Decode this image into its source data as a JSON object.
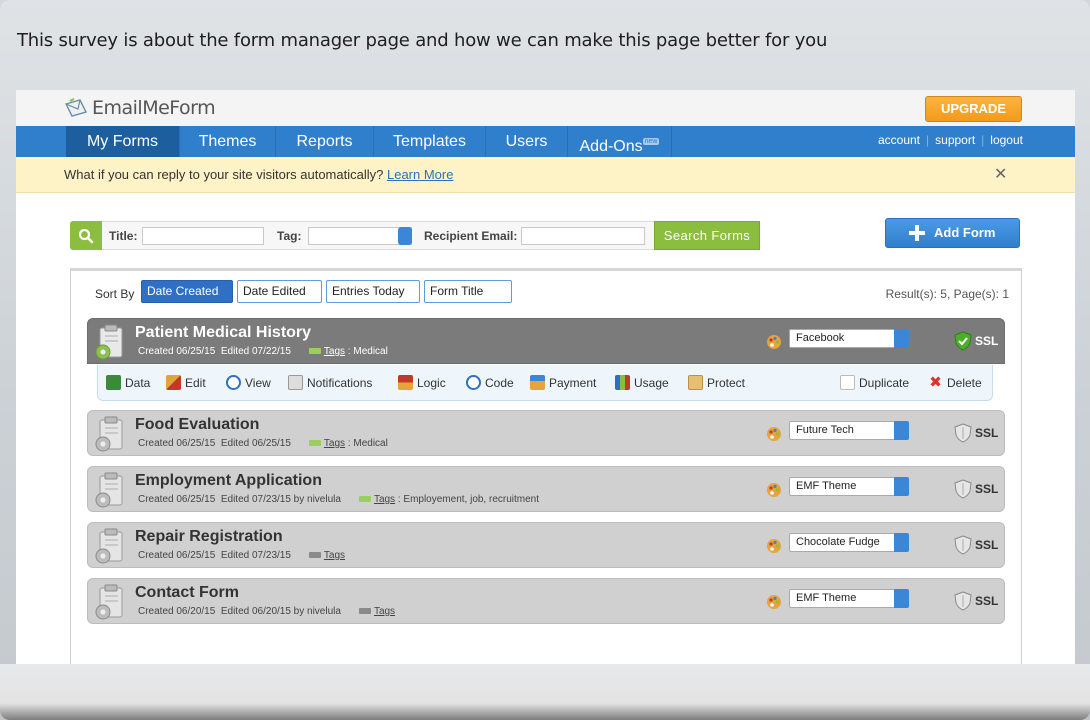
{
  "survey_text": "This survey is about the form manager page and how we can make this page better for you",
  "header": {
    "logo_text": "EmailMeForm",
    "upgrade_label": "UPGRADE"
  },
  "nav": {
    "items": [
      "My Forms",
      "Themes",
      "Reports",
      "Templates",
      "Users",
      "Add-Ons"
    ],
    "addons_badge": "new",
    "account": "account",
    "support": "support",
    "logout": "logout"
  },
  "notice": {
    "text": "What if you can reply to your site visitors automatically?",
    "link": "Learn More",
    "close": "✕"
  },
  "search": {
    "title_label": "Title:",
    "tag_label": "Tag:",
    "recipient_label": "Recipient Email:",
    "search_button": "Search Forms",
    "add_form_button": "Add Form"
  },
  "sort": {
    "label": "Sort By",
    "options": [
      "Date Created",
      "Date Edited",
      "Entries Today",
      "Form Title"
    ],
    "results": "Result(s): 5, Page(s): 1"
  },
  "forms": [
    {
      "title": "Patient Medical History",
      "created": "Created 06/25/15",
      "edited": "Edited 07/22/15",
      "by": "",
      "tags_label": "Tags",
      "tags": " : Medical",
      "theme": "Facebook",
      "ssl": "SSL"
    },
    {
      "title": "Food Evaluation",
      "created": "Created 06/25/15",
      "edited": "Edited 06/25/15",
      "by": "",
      "tags_label": "Tags",
      "tags": " : Medical",
      "theme": "Future Tech",
      "ssl": "SSL"
    },
    {
      "title": "Employment Application",
      "created": "Created 06/25/15",
      "edited": "Edited 07/23/15 by nivelula",
      "by": "",
      "tags_label": "Tags",
      "tags": " : Employement, job, recruitment",
      "theme": "EMF Theme",
      "ssl": "SSL"
    },
    {
      "title": "Repair Registration",
      "created": "Created 06/25/15",
      "edited": "Edited 07/23/15",
      "by": "",
      "tags_label": "Tags",
      "tags": "",
      "theme": "Chocolate Fudge",
      "ssl": "SSL"
    },
    {
      "title": "Contact Form",
      "created": "Created 06/20/15",
      "edited": "Edited 06/20/15 by nivelula",
      "by": "",
      "tags_label": "Tags",
      "tags": "",
      "theme": "EMF Theme",
      "ssl": "SSL"
    }
  ],
  "actions": [
    "Data",
    "Edit",
    "View",
    "Notifications",
    "Logic",
    "Code",
    "Payment",
    "Usage",
    "Protect",
    "Duplicate",
    "Delete"
  ],
  "colors": {
    "nav_blue": "#2f7fcc",
    "nav_active": "#1c5e9e",
    "search_green": "#8bbd3e",
    "upgrade_orange": "#f7a52a",
    "notice_yellow": "#fdf3c6"
  }
}
